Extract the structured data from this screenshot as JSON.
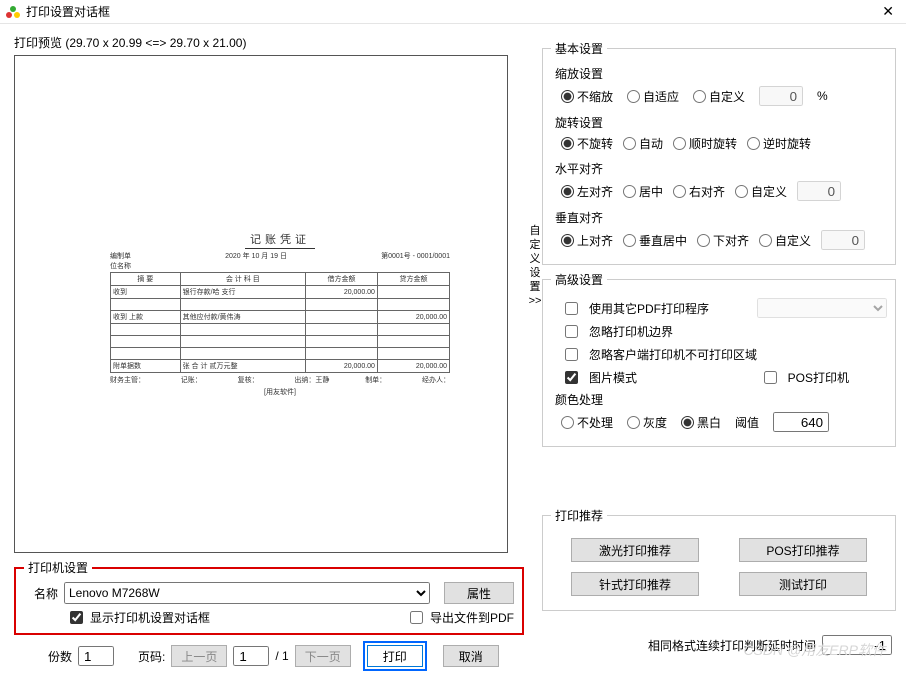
{
  "window": {
    "title": "打印设置对话框",
    "close": "✕"
  },
  "preview": {
    "label": "打印预览 (29.70 x 20.99 <=> 29.70 x 21.00)",
    "voucher_title": "记账凭证",
    "date": "2020 年 10 月 19 日",
    "no": "第0001号 - 0001/0001",
    "th1": "摘    要",
    "th2": "会 计 科 目",
    "th3": "借方金额",
    "th4": "贷方金额",
    "r1a": "收到",
    "r1b": "银行存款/哈      支行",
    "r1c": "20,000.00",
    "r1d": "",
    "r2a": "收到      上款",
    "r2b": "其他应付款/黄伟涛",
    "r2c": "",
    "r2d": "20,000.00",
    "sum_label": "附单据数",
    "sum_text": "张   合 计  贰万元整",
    "sum_d": "20,000.00",
    "sum_c": "20,000.00",
    "f1": "财务主管：",
    "f2": "记账：",
    "f3": "复核：",
    "f4": "出纳：王静",
    "f5": "制单：",
    "f6": "经办人：",
    "brand": "[用友软件]"
  },
  "printer": {
    "legend": "打印机设置",
    "name_label": "名称",
    "name_value": "Lenovo M7268W",
    "properties": "属性",
    "show_dialog": "显示打印机设置对话框",
    "export_pdf": "导出文件到PDF"
  },
  "bottom": {
    "copies_label": "份数",
    "copies": "1",
    "page_label": "页码:",
    "prev": "上一页",
    "page": "1",
    "total": "/ 1",
    "next": "下一页",
    "print": "打印",
    "cancel": "取消"
  },
  "side_label": "自定义设置>>",
  "basic": {
    "legend": "基本设置",
    "scale_label": "缩放设置",
    "scale_none": "不缩放",
    "scale_fit": "自适应",
    "scale_custom": "自定义",
    "scale_val": "0",
    "pct": "%",
    "rotate_label": "旋转设置",
    "rot_none": "不旋转",
    "rot_auto": "自动",
    "rot_cw": "顺时旋转",
    "rot_ccw": "逆时旋转",
    "halign_label": "水平对齐",
    "h_left": "左对齐",
    "h_center": "居中",
    "h_right": "右对齐",
    "h_custom": "自定义",
    "h_val": "0",
    "valign_label": "垂直对齐",
    "v_top": "上对齐",
    "v_center": "垂直居中",
    "v_bottom": "下对齐",
    "v_custom": "自定义",
    "v_val": "0"
  },
  "adv": {
    "legend": "高级设置",
    "use_other_pdf": "使用其它PDF打印程序",
    "ignore_margin": "忽略打印机边界",
    "ignore_unprint": "忽略客户端打印机不可打印区域",
    "image_mode": "图片模式",
    "pos_printer": "POS打印机",
    "color_label": "颜色处理",
    "c_none": "不处理",
    "c_gray": "灰度",
    "c_bw": "黑白",
    "threshold_label": "阈值",
    "threshold": "640"
  },
  "rec": {
    "legend": "打印推荐",
    "laser": "激光打印推荐",
    "pos": "POS打印推荐",
    "needle": "针式打印推荐",
    "test": "测试打印"
  },
  "delay": {
    "label": "相同格式连续打印判断延时时间",
    "value": "-1"
  },
  "watermark": "CSDN @用友ERP软件"
}
